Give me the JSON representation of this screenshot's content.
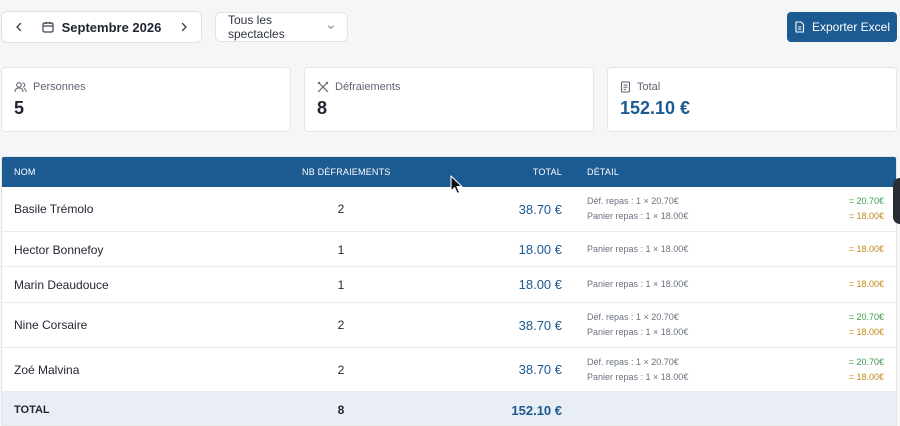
{
  "toolbar": {
    "prev_icon": "chevron-left-icon",
    "next_icon": "chevron-right-icon",
    "calendar_icon": "calendar-icon",
    "month_label": "Septembre 2026",
    "show_filter": "Tous les spectacles",
    "export_label": "Exporter Excel"
  },
  "stats": {
    "persons": {
      "label": "Personnes",
      "value": "5",
      "icon": "users-icon"
    },
    "defraiements": {
      "label": "Défraiements",
      "value": "8",
      "icon": "utensils-icon"
    },
    "total": {
      "label": "Total",
      "value": "152.10 €",
      "icon": "receipt-icon"
    }
  },
  "table": {
    "headers": {
      "name": "NOM",
      "nb": "NB DÉFRAIEMENTS",
      "total": "TOTAL",
      "detail": "DÉTAIL"
    },
    "rows": [
      {
        "name": "Basile Trémolo",
        "nb": "2",
        "total": "38.70 €",
        "details": [
          {
            "label": "Déf. repas : 1 × 20.70€",
            "amount": "= 20.70€"
          },
          {
            "label": "Panier repas : 1 × 18.00€",
            "amount": "= 18.00€"
          }
        ]
      },
      {
        "name": "Hector Bonnefoy",
        "nb": "1",
        "total": "18.00 €",
        "details": [
          {
            "label": "Panier repas : 1 × 18.00€",
            "amount": "= 18.00€"
          }
        ]
      },
      {
        "name": "Marin Deaudouce",
        "nb": "1",
        "total": "18.00 €",
        "details": [
          {
            "label": "Panier repas : 1 × 18.00€",
            "amount": "= 18.00€"
          }
        ]
      },
      {
        "name": "Nine Corsaire",
        "nb": "2",
        "total": "38.70 €",
        "details": [
          {
            "label": "Déf. repas : 1 × 20.70€",
            "amount": "= 20.70€"
          },
          {
            "label": "Panier repas : 1 × 18.00€",
            "amount": "= 18.00€"
          }
        ]
      },
      {
        "name": "Zoé Malvina",
        "nb": "2",
        "total": "38.70 €",
        "details": [
          {
            "label": "Déf. repas : 1 × 20.70€",
            "amount": "= 20.70€"
          },
          {
            "label": "Panier repas : 1 × 18.00€",
            "amount": "= 18.00€"
          }
        ]
      }
    ],
    "footer": {
      "name": "TOTAL",
      "nb": "8",
      "total": "152.10 €"
    }
  },
  "colors": {
    "primary": "#1c5a92",
    "amount_repas": "#3d9b4d",
    "amount_panier": "#c08a18"
  }
}
